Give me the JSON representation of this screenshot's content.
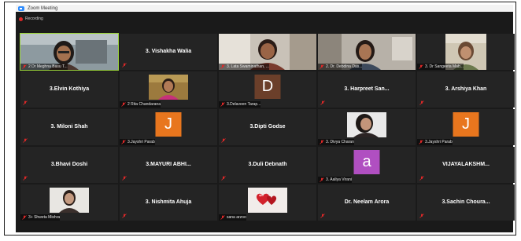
{
  "window": {
    "title": "Zoom Meeting"
  },
  "recording": {
    "label": "Recording"
  },
  "tiles": [
    {
      "kind": "photo",
      "label": "2 Dr Meghna Basu T...",
      "active": true
    },
    {
      "kind": "name",
      "name": "3. Vishakha Walia"
    },
    {
      "kind": "photo",
      "label": "3. Lata Swaminathan, ..."
    },
    {
      "kind": "photo",
      "label": "2. Dr. Debdina Das..."
    },
    {
      "kind": "photo",
      "label": "3. Dr Sangeeta Mab..."
    },
    {
      "kind": "name",
      "name": "3.Elvin Kothiya"
    },
    {
      "kind": "thumb",
      "label": "2 Rita Chandarana"
    },
    {
      "kind": "letter",
      "letter": "D",
      "label": "3.Delaveen Tarap..."
    },
    {
      "kind": "name",
      "name": "3. Harpreet San..."
    },
    {
      "kind": "name",
      "name": "3. Arshiya Khan"
    },
    {
      "kind": "name",
      "name": "3. Miloni Shah"
    },
    {
      "kind": "letter",
      "letter": "J",
      "label": "3.Jayshri Parab"
    },
    {
      "kind": "name",
      "name": "3.Dipti Godse"
    },
    {
      "kind": "thumb",
      "label": "3. Divya Charan"
    },
    {
      "kind": "letter",
      "letter": "J",
      "label": "3.Jayshri Parab"
    },
    {
      "kind": "name",
      "name": "3.Bhavi Doshi"
    },
    {
      "kind": "name",
      "name": "3.MAYURI ABHI..."
    },
    {
      "kind": "name",
      "name": "3.Duli Debnath"
    },
    {
      "kind": "letter",
      "letter": "a",
      "label": "3. Aaliya Virani"
    },
    {
      "kind": "name",
      "name": "VIJAYALAKSHM..."
    },
    {
      "kind": "thumb",
      "label": "3+ Shweta Mishra"
    },
    {
      "kind": "name",
      "name": "3. Nishmita Ahuja"
    },
    {
      "kind": "thumb",
      "label": "sana arzoo"
    },
    {
      "kind": "name",
      "name": "Dr. Neelam Arora"
    },
    {
      "kind": "name",
      "name": "3.Sachin Choura..."
    }
  ],
  "colors": {
    "active_border": "#9bd33b",
    "mute": "#e02828",
    "avatar_brown": "#6b3f2a",
    "avatar_orange": "#e8761e",
    "avatar_purple": "#b04fc1"
  }
}
